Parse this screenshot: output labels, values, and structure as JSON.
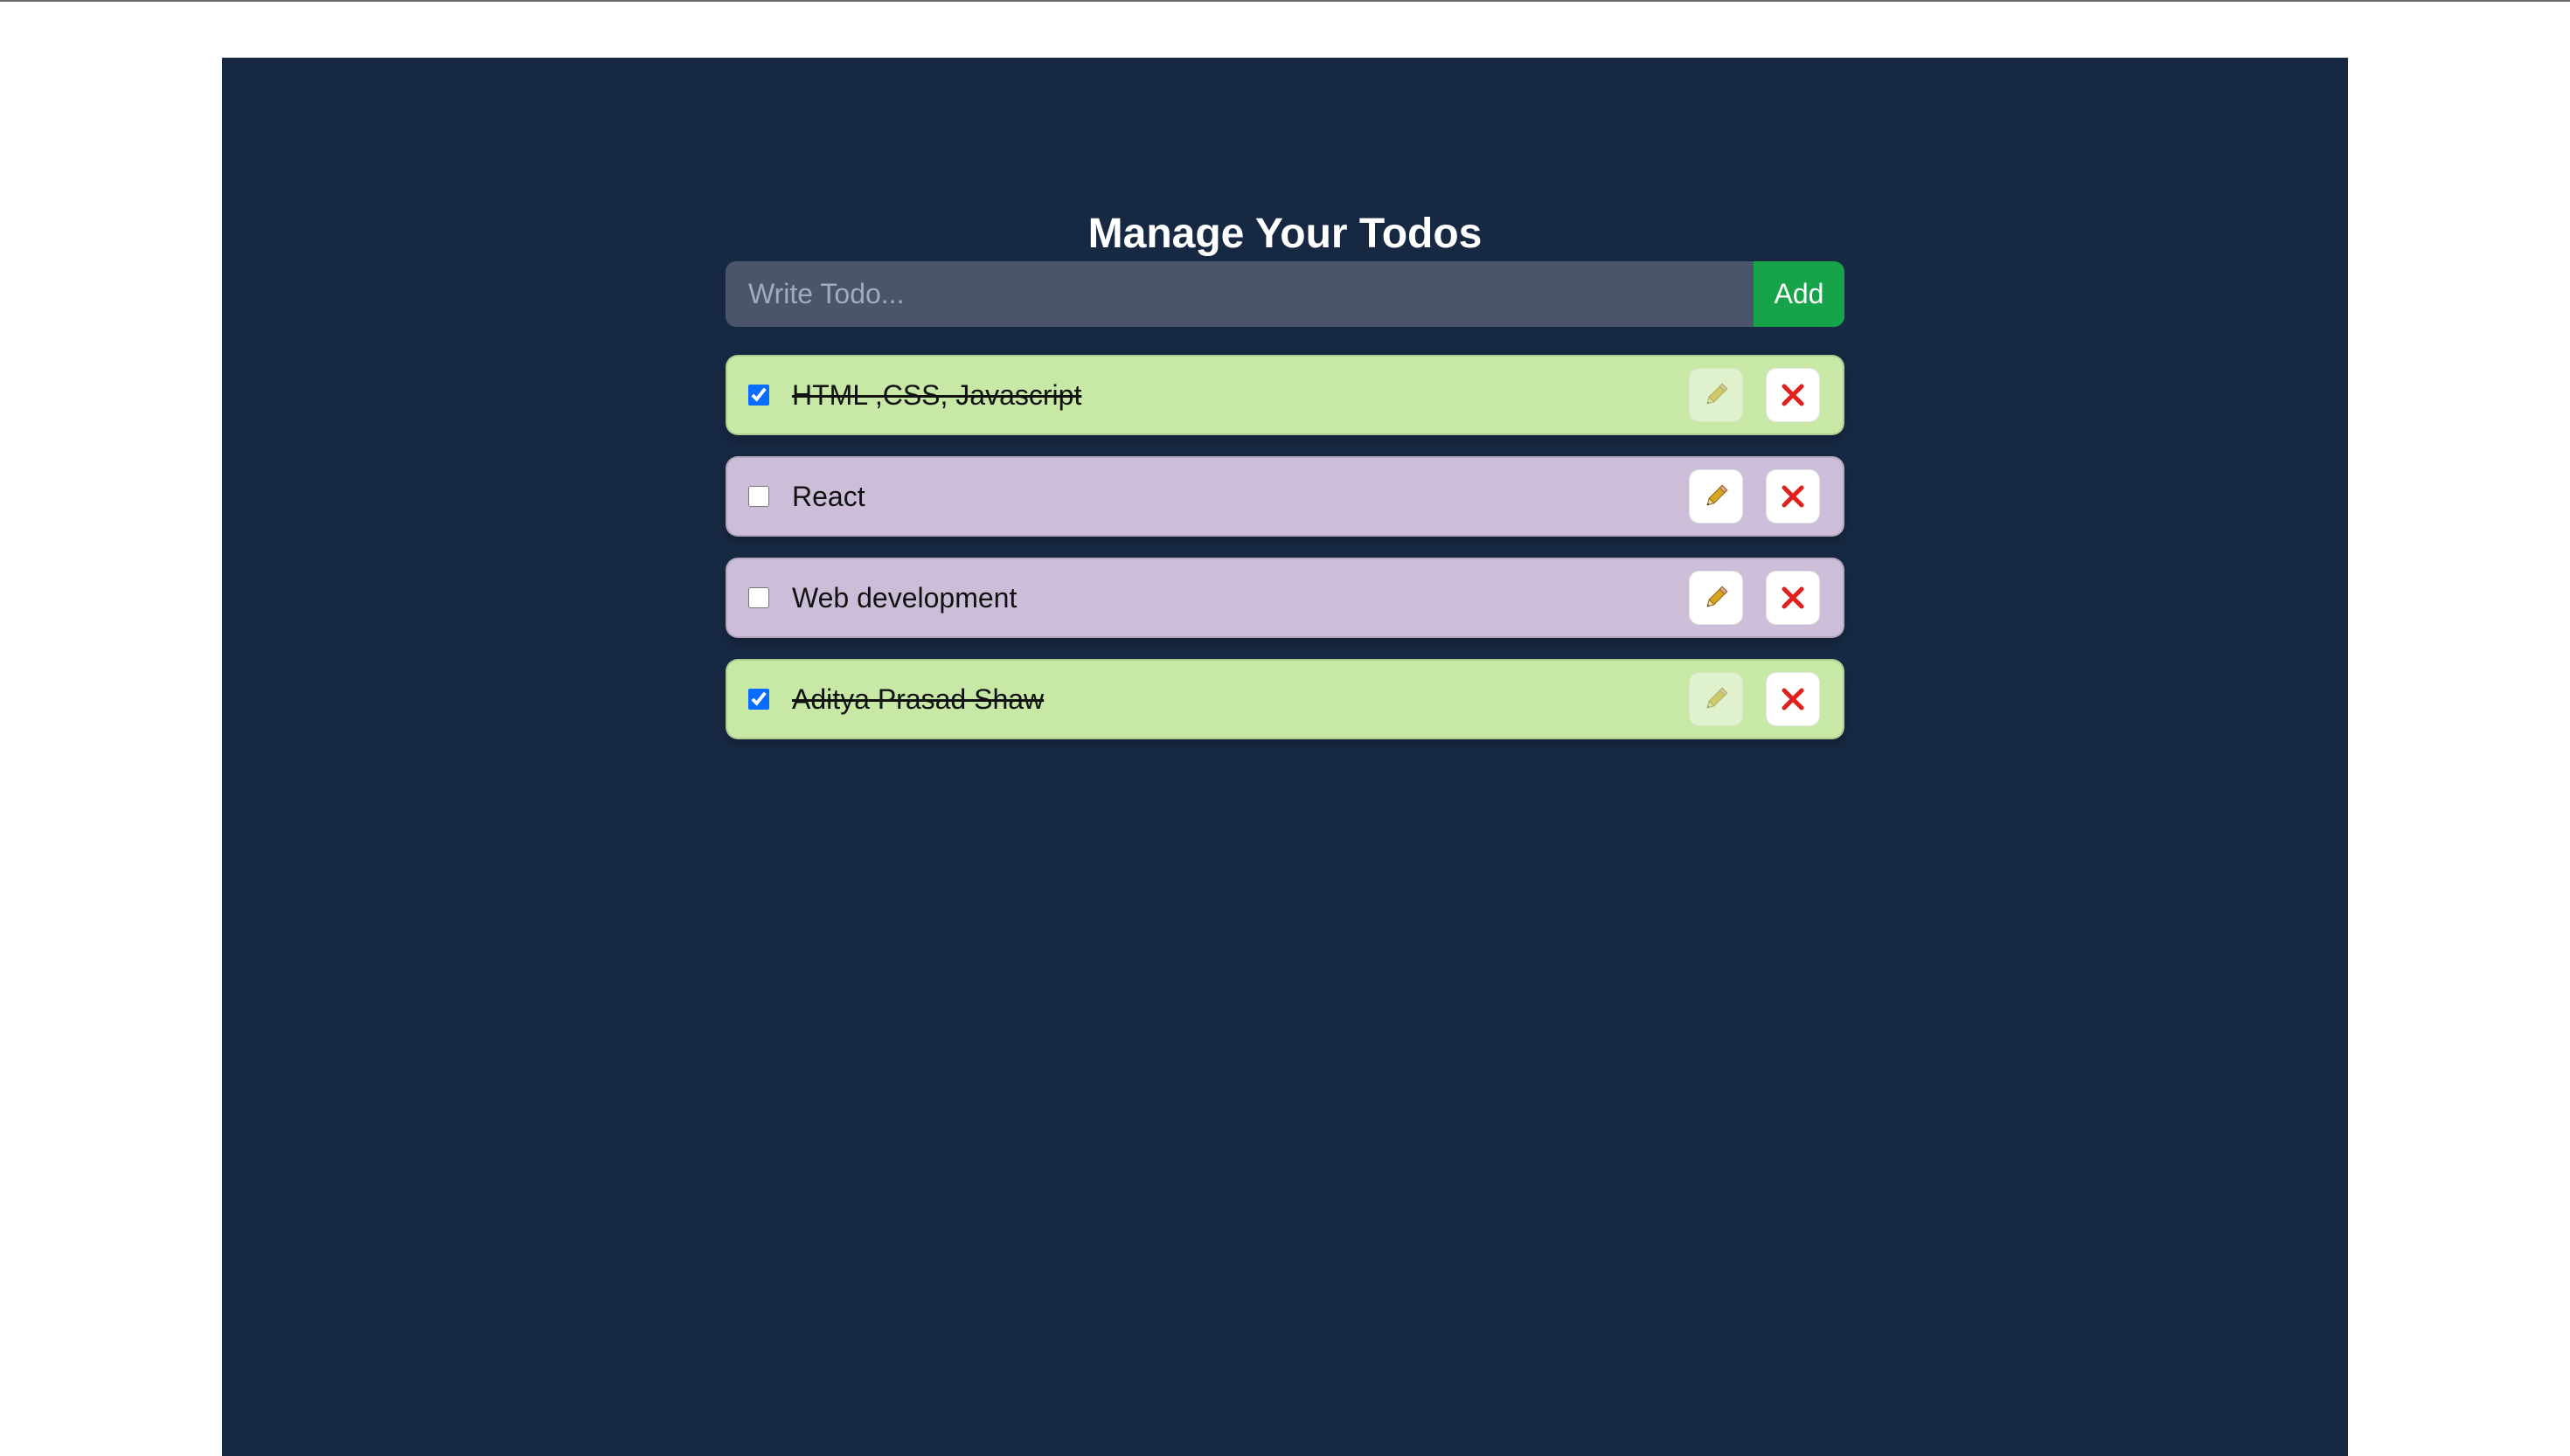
{
  "page": {
    "title": "Manage Your Todos"
  },
  "form": {
    "placeholder": "Write Todo...",
    "value": "",
    "add_label": "Add"
  },
  "todos": [
    {
      "text": "HTML ,CSS, Javascript",
      "completed": true
    },
    {
      "text": "React",
      "completed": false
    },
    {
      "text": "Web development",
      "completed": false
    },
    {
      "text": "Aditya Prasad Shaw",
      "completed": true
    }
  ],
  "icons": {
    "edit": "pencil-icon",
    "delete": "close-icon"
  },
  "colors": {
    "page_bg": "#ffffff",
    "panel_bg": "#172842",
    "input_bg": "#4a556c",
    "add_button": "#16a34a",
    "todo_done": "#c7e9a5",
    "todo_open": "#ccbed8",
    "delete_x": "#e0201c",
    "pencil": "#d9a520"
  }
}
